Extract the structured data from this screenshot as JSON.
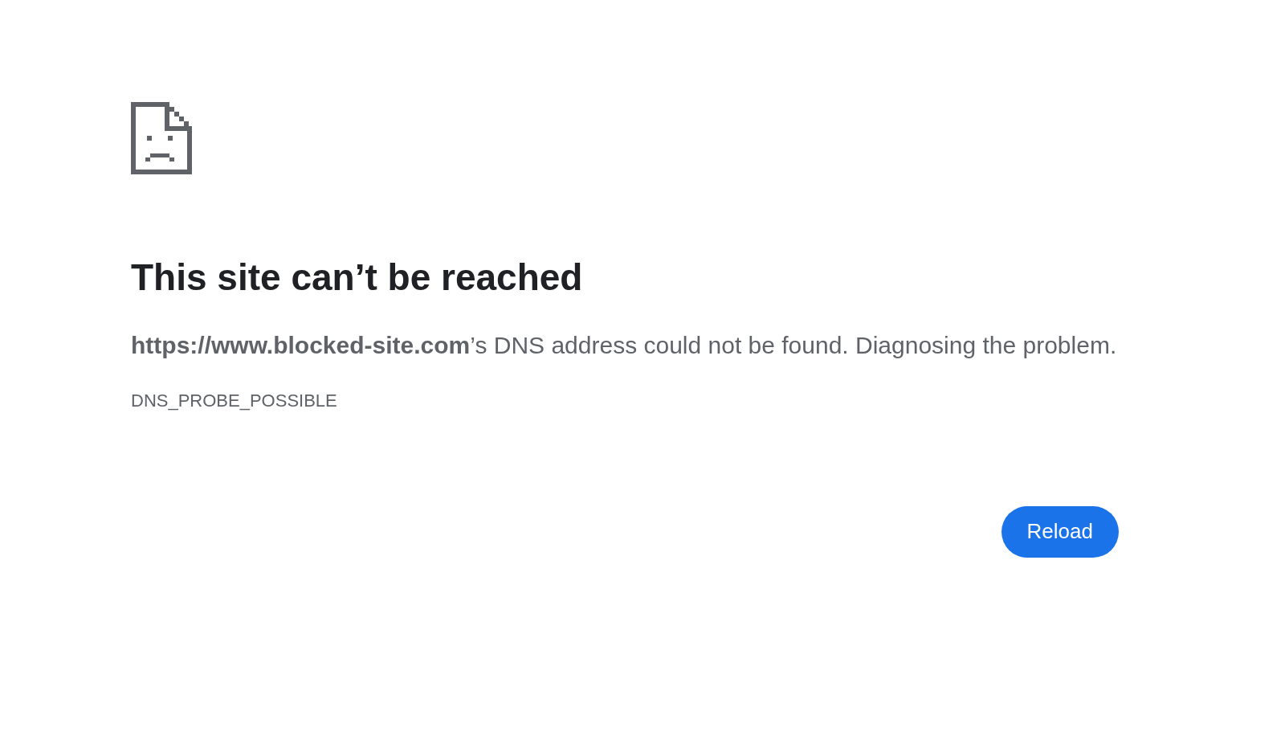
{
  "heading": "This site can’t be reached",
  "message": "**https://www.blocked-site.com**’s DNS address could not be found. Diagnosing the problem.",
  "error_code": "DNS_PROBE_POSSIBLE",
  "buttons": [
    "Reload"
  ]
}
